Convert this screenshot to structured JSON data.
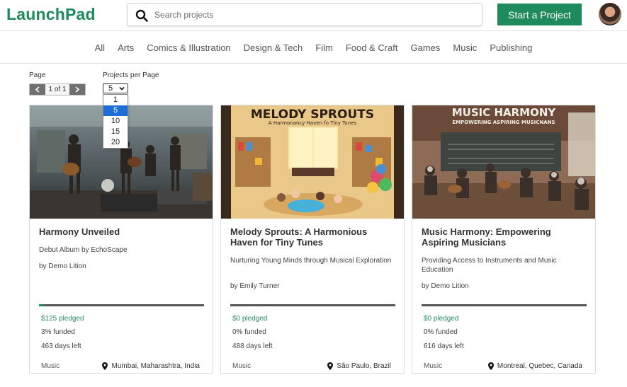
{
  "header": {
    "logo": "LaunchPad",
    "search_placeholder": "Search projects",
    "start_button": "Start a Project"
  },
  "categories": [
    "All",
    "Arts",
    "Comics & Illustration",
    "Design & Tech",
    "Film",
    "Food & Craft",
    "Games",
    "Music",
    "Publishing"
  ],
  "pagination": {
    "page_label": "Page",
    "page_indicator": "1 of 1",
    "per_page_label": "Projects per Page",
    "per_page_value": "5",
    "per_page_options": [
      "1",
      "5",
      "10",
      "15",
      "20"
    ],
    "selected_option": "5"
  },
  "projects": [
    {
      "title": "Harmony Unveiled",
      "description": "Debut Album by EchoScape",
      "creator": "by Demo Lition",
      "pledged": "$125 pledged",
      "funded": "3% funded",
      "funded_fraction": 0.03,
      "days_left": "463 days left",
      "category": "Music",
      "location": "Mumbai, Maharashtra, India"
    },
    {
      "title": "Melody Sprouts: A Harmonious Haven for Tiny Tunes",
      "description": "Nurturing Young Minds through Musical Exploration",
      "creator": "by Emily Turner",
      "pledged": "$0 pledged",
      "funded": "0% funded",
      "funded_fraction": 0.0,
      "days_left": "488 days left",
      "category": "Music",
      "location": "São Paulo, Brazil",
      "image_text": "MELODY SPROUTS",
      "image_subtext": "A Harmonancy Haven fo Tiny Tunes"
    },
    {
      "title": "Music Harmony: Empowering Aspiring Musicians",
      "description": "Providing Access to Instruments and Music Education",
      "creator": "by Demo Lition",
      "pledged": "$0 pledged",
      "funded": "0% funded",
      "funded_fraction": 0.0,
      "days_left": "616 days left",
      "category": "Music",
      "location": "Montreal, Quebec, Canada",
      "image_text": "MUSIC HARMONY",
      "image_subtext": "EMPOWERING ASPIRING MUSICNANS"
    }
  ],
  "colors": {
    "brand": "#1f8a5b",
    "selected_option": "#1e6cd6",
    "pager_arrow": "#707070"
  }
}
